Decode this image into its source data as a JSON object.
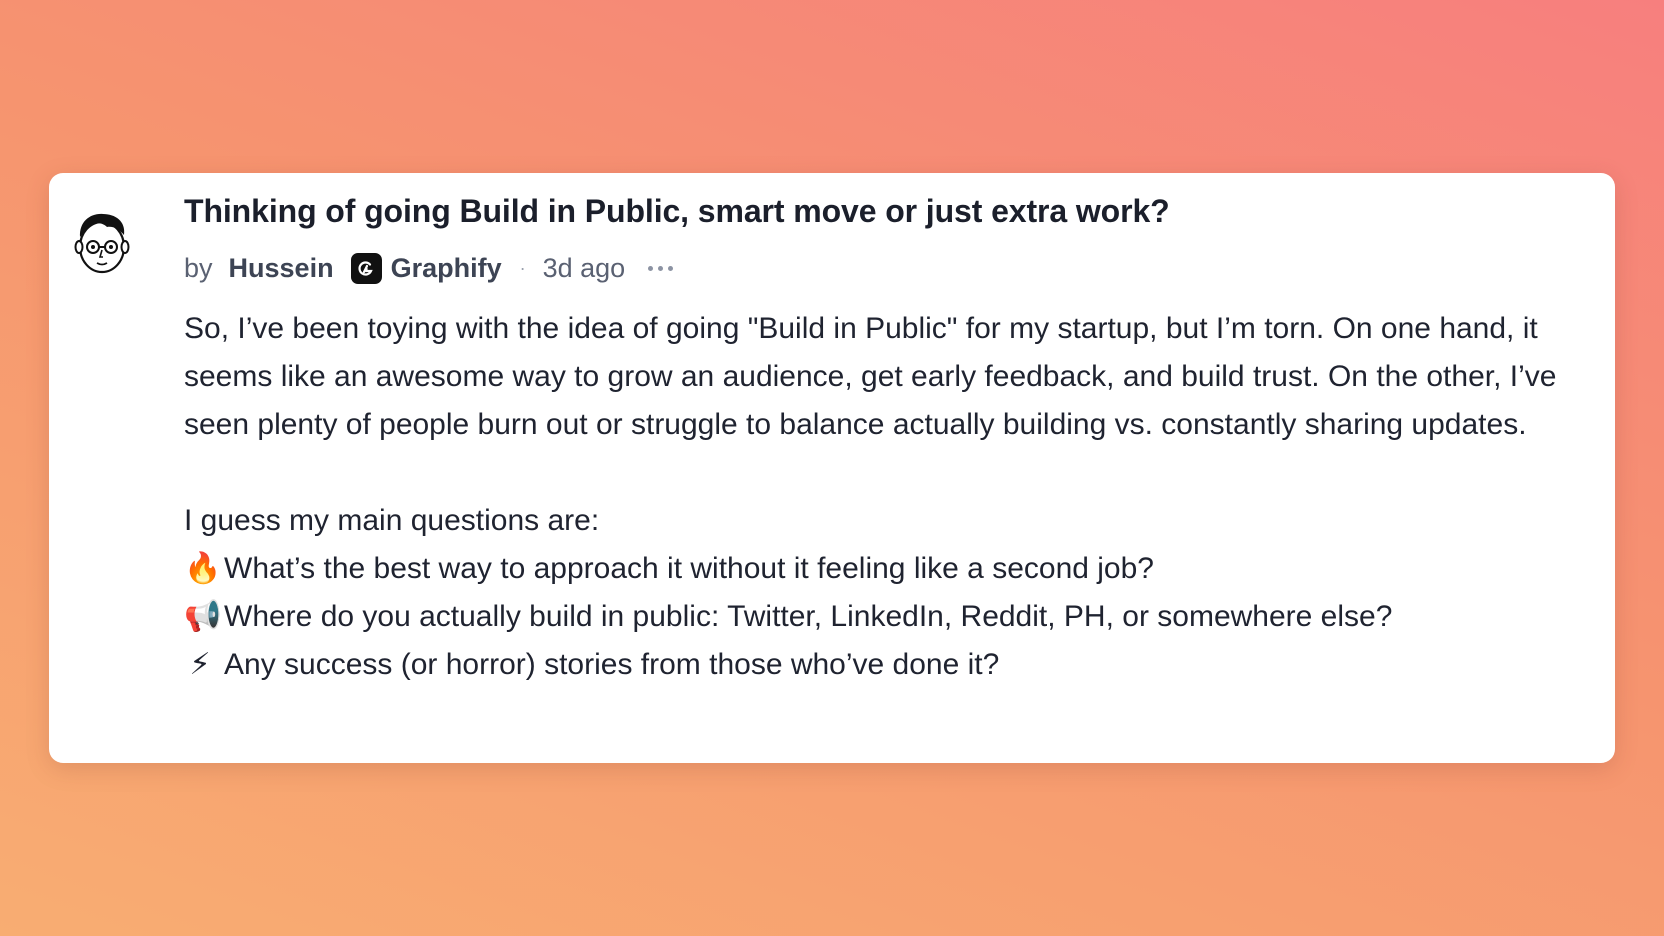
{
  "post": {
    "title": "Thinking of going Build in Public, smart move or just extra work?",
    "by_label": "by",
    "author": "Hussein",
    "company": "Graphify",
    "separator": "·",
    "time_ago": "3d ago",
    "paragraph": "So, I’ve been toying with the idea of going \"Build in Public\" for my startup, but I’m torn. On one hand, it seems like an awesome way to grow an audience, get early feedback, and build trust. On the other, I’ve seen plenty of people burn out or struggle to balance actually building vs. constantly sharing updates.",
    "questions_intro": "I guess my main questions are:",
    "questions": [
      {
        "emoji": "🔥",
        "icon": "fire-icon",
        "text": "What’s the best way to approach it without it feeling like a second job?"
      },
      {
        "emoji": "📢",
        "icon": "megaphone-icon",
        "text": "Where do you actually build in public: Twitter, LinkedIn, Reddit, PH, or somewhere else?"
      },
      {
        "emoji": "⚡",
        "icon": "lightning-icon",
        "text": "Any success (or horror) stories from those who’ve done it?"
      }
    ]
  },
  "colors": {
    "background_start": "#f77f7e",
    "background_end": "#f8ad72",
    "card": "#ffffff",
    "text": "#1f2330",
    "meta": "#5a6172"
  }
}
